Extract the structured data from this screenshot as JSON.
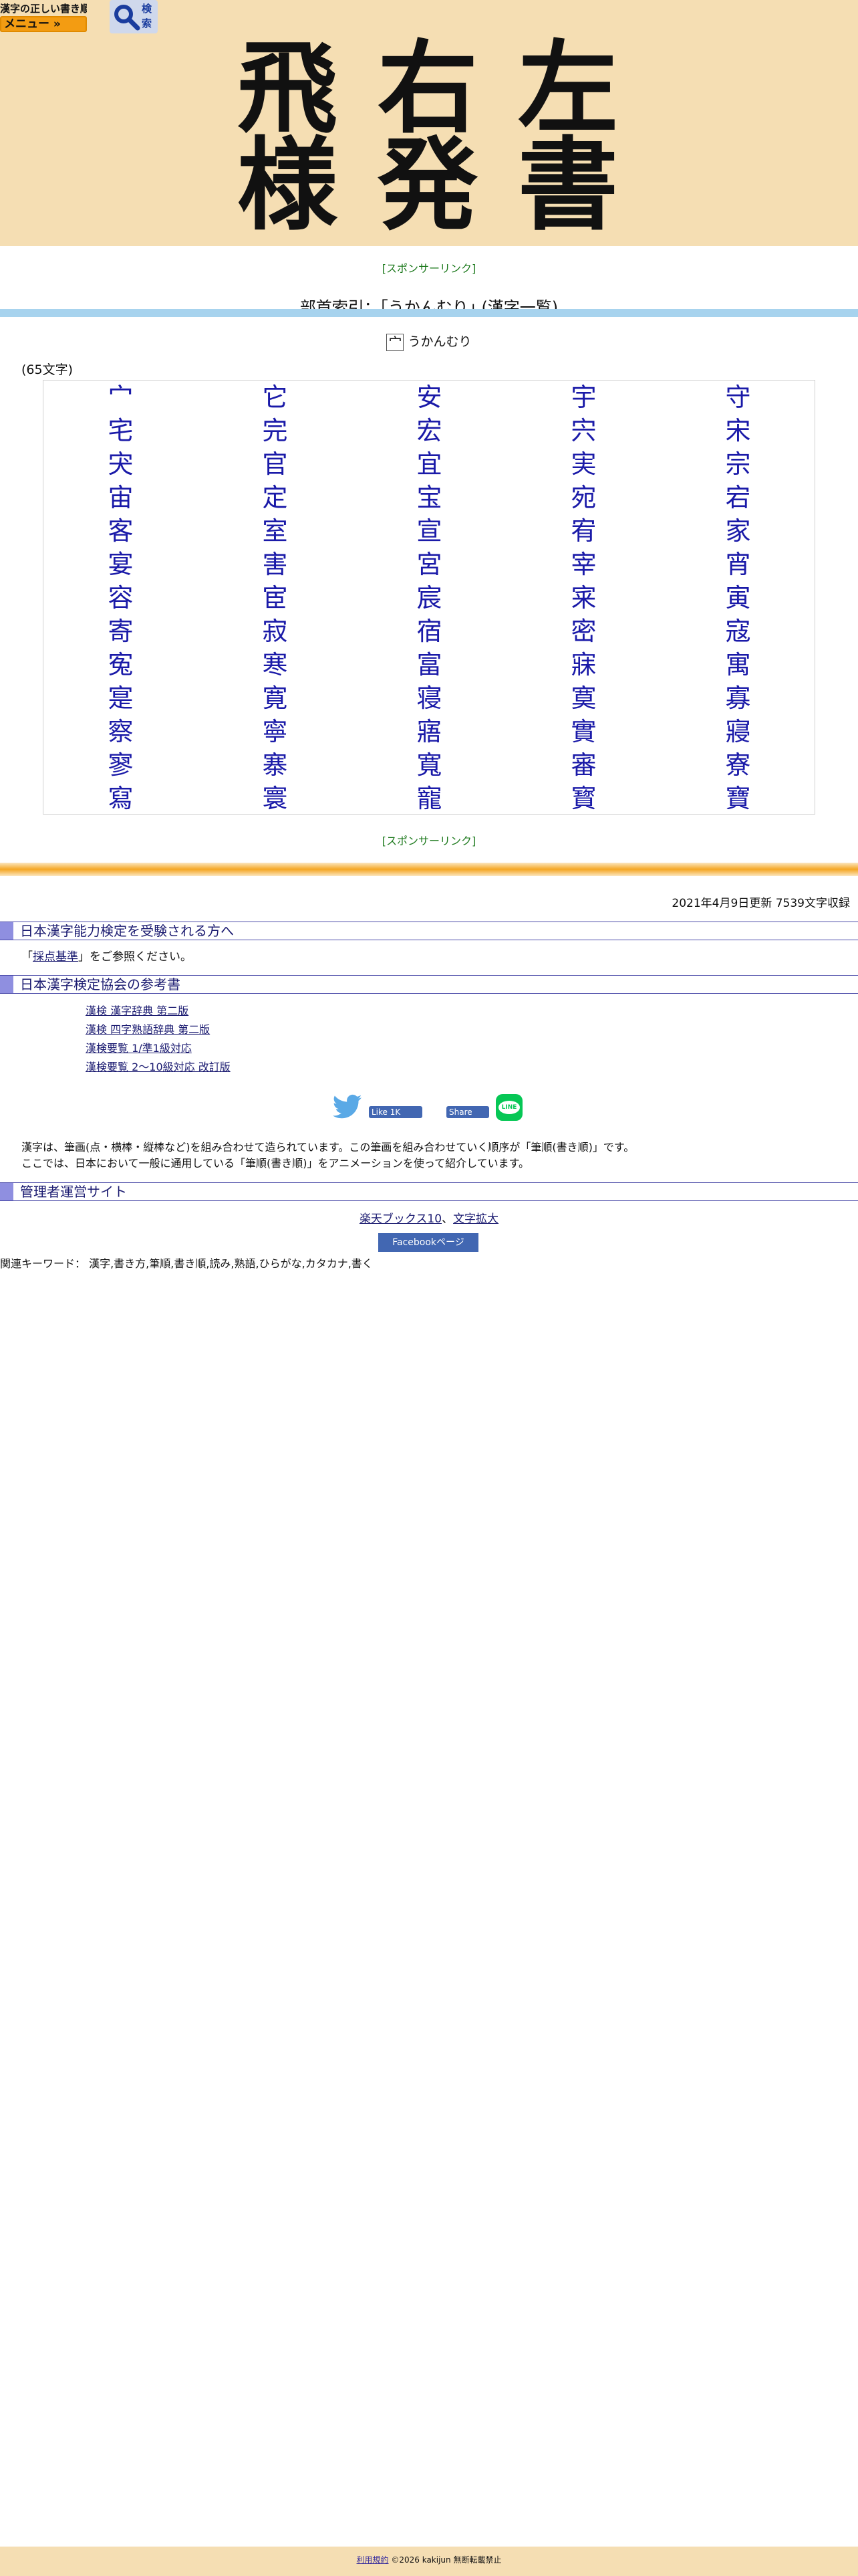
{
  "header": {
    "logo_text": "漢字の正しい書き順(筆順)",
    "menu_label": "メニュー »",
    "search_label": "検索",
    "hero_chars": [
      [
        "飛",
        "右",
        "左"
      ],
      [
        "様",
        "発",
        "書"
      ]
    ]
  },
  "sponsor_label": "[スポンサーリンク]",
  "page_title": "部首索引：｢うかんむり｣ (漢字一覧)",
  "radical": {
    "glyph": "宀",
    "name": "うかんむり"
  },
  "count_text": "(65文字)",
  "kanji": [
    "宀",
    "它",
    "安",
    "宇",
    "守",
    "宅",
    "完",
    "宏",
    "宍",
    "宋",
    "宊",
    "官",
    "宜",
    "実",
    "宗",
    "宙",
    "定",
    "宝",
    "宛",
    "宕",
    "客",
    "室",
    "宣",
    "宥",
    "家",
    "宴",
    "害",
    "宮",
    "宰",
    "宵",
    "容",
    "宦",
    "宸",
    "宷",
    "寅",
    "寄",
    "寂",
    "宿",
    "密",
    "寇",
    "寃",
    "寒",
    "富",
    "寐",
    "寓",
    "寔",
    "寛",
    "寝",
    "寞",
    "寡",
    "察",
    "寧",
    "寤",
    "實",
    "寢",
    "寥",
    "寨",
    "寬",
    "審",
    "寮",
    "寫",
    "寰",
    "寵",
    "寳",
    "寶"
  ],
  "updated_text": "2021年4月9日更新 7539文字収録",
  "sections": {
    "exam_heading": "日本漢字能力検定を受験される方へ",
    "exam_notice_pre": "「",
    "exam_notice_link": "採点基準",
    "exam_notice_post": "」をご参照ください。",
    "books_heading": "日本漢字検定協会の参考書",
    "books": [
      "漢検 漢字辞典 第二版",
      "漢検 四字熟語辞典 第二版",
      "漢検要覧 1/準1級対応",
      "漢検要覧 2～10級対応 改訂版"
    ],
    "admin_heading": "管理者運営サイト",
    "admin_link_1": "楽天ブックス10",
    "admin_sep": "、",
    "admin_link_2": "文字拡大"
  },
  "share": {
    "fb_like": "Like 1K",
    "fb_share": "Share",
    "line_label": "LINE"
  },
  "description_line1": "漢字は、筆画(点・横棒・縦棒など)を組み合わせて造られています。この筆画を組み合わせていく順序が「筆順(書き順)」です。",
  "description_line2": "ここでは、日本において一般に通用している「筆順(書き順)」をアニメーションを使って紹介しています。",
  "facebook_page_label": "Facebookページ",
  "keywords_text": "関連キーワード： 漢字,書き方,筆順,書き順,読み,熟語,ひらがな,カタカナ,書く",
  "footer": {
    "terms_link": "利用規約",
    "copyright": " ©2026 kakijun 無断転載禁止"
  },
  "colors": {
    "header_bg": "#f5deb3",
    "accent_blue": "#a7d3ee",
    "kanji_link": "#1a1aa8",
    "orange": "#f5a623"
  }
}
